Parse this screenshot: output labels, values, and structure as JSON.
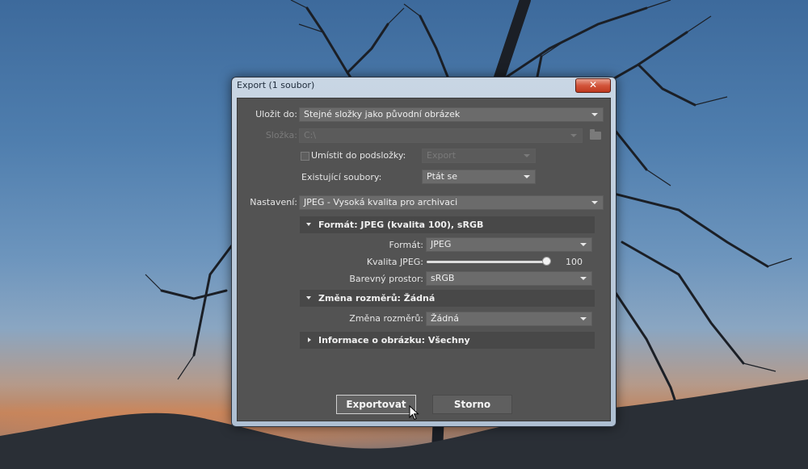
{
  "window": {
    "title": "Export (1 soubor)",
    "close_glyph": "✕"
  },
  "save_to": {
    "label": "Uložit do:",
    "value": "Stejné složky jako původní obrázek"
  },
  "folder": {
    "label": "Složka:",
    "value": "C:\\",
    "icon": "folder-icon"
  },
  "subfolder": {
    "label": "Umístit do podsložky:",
    "value": "Export",
    "checked": false
  },
  "existing": {
    "label": "Existující soubory:",
    "value": "Ptát se"
  },
  "preset": {
    "label": "Nastavení:",
    "value": "JPEG - Vysoká kvalita pro archivaci"
  },
  "format_section": {
    "header": "Formát: JPEG (kvalita 100), sRGB",
    "format_label": "Formát:",
    "format_value": "JPEG",
    "quality_label": "Kvalita JPEG:",
    "quality_value": "100",
    "quality_fraction": 1.0,
    "colorspace_label": "Barevný prostor:",
    "colorspace_value": "sRGB"
  },
  "resize_section": {
    "header": "Změna rozměrů: Žádná",
    "resize_label": "Změna rozměrů:",
    "resize_value": "Žádná"
  },
  "info_section": {
    "header": "Informace o obrázku: Všechny"
  },
  "buttons": {
    "export": "Exportovat",
    "cancel": "Storno"
  }
}
